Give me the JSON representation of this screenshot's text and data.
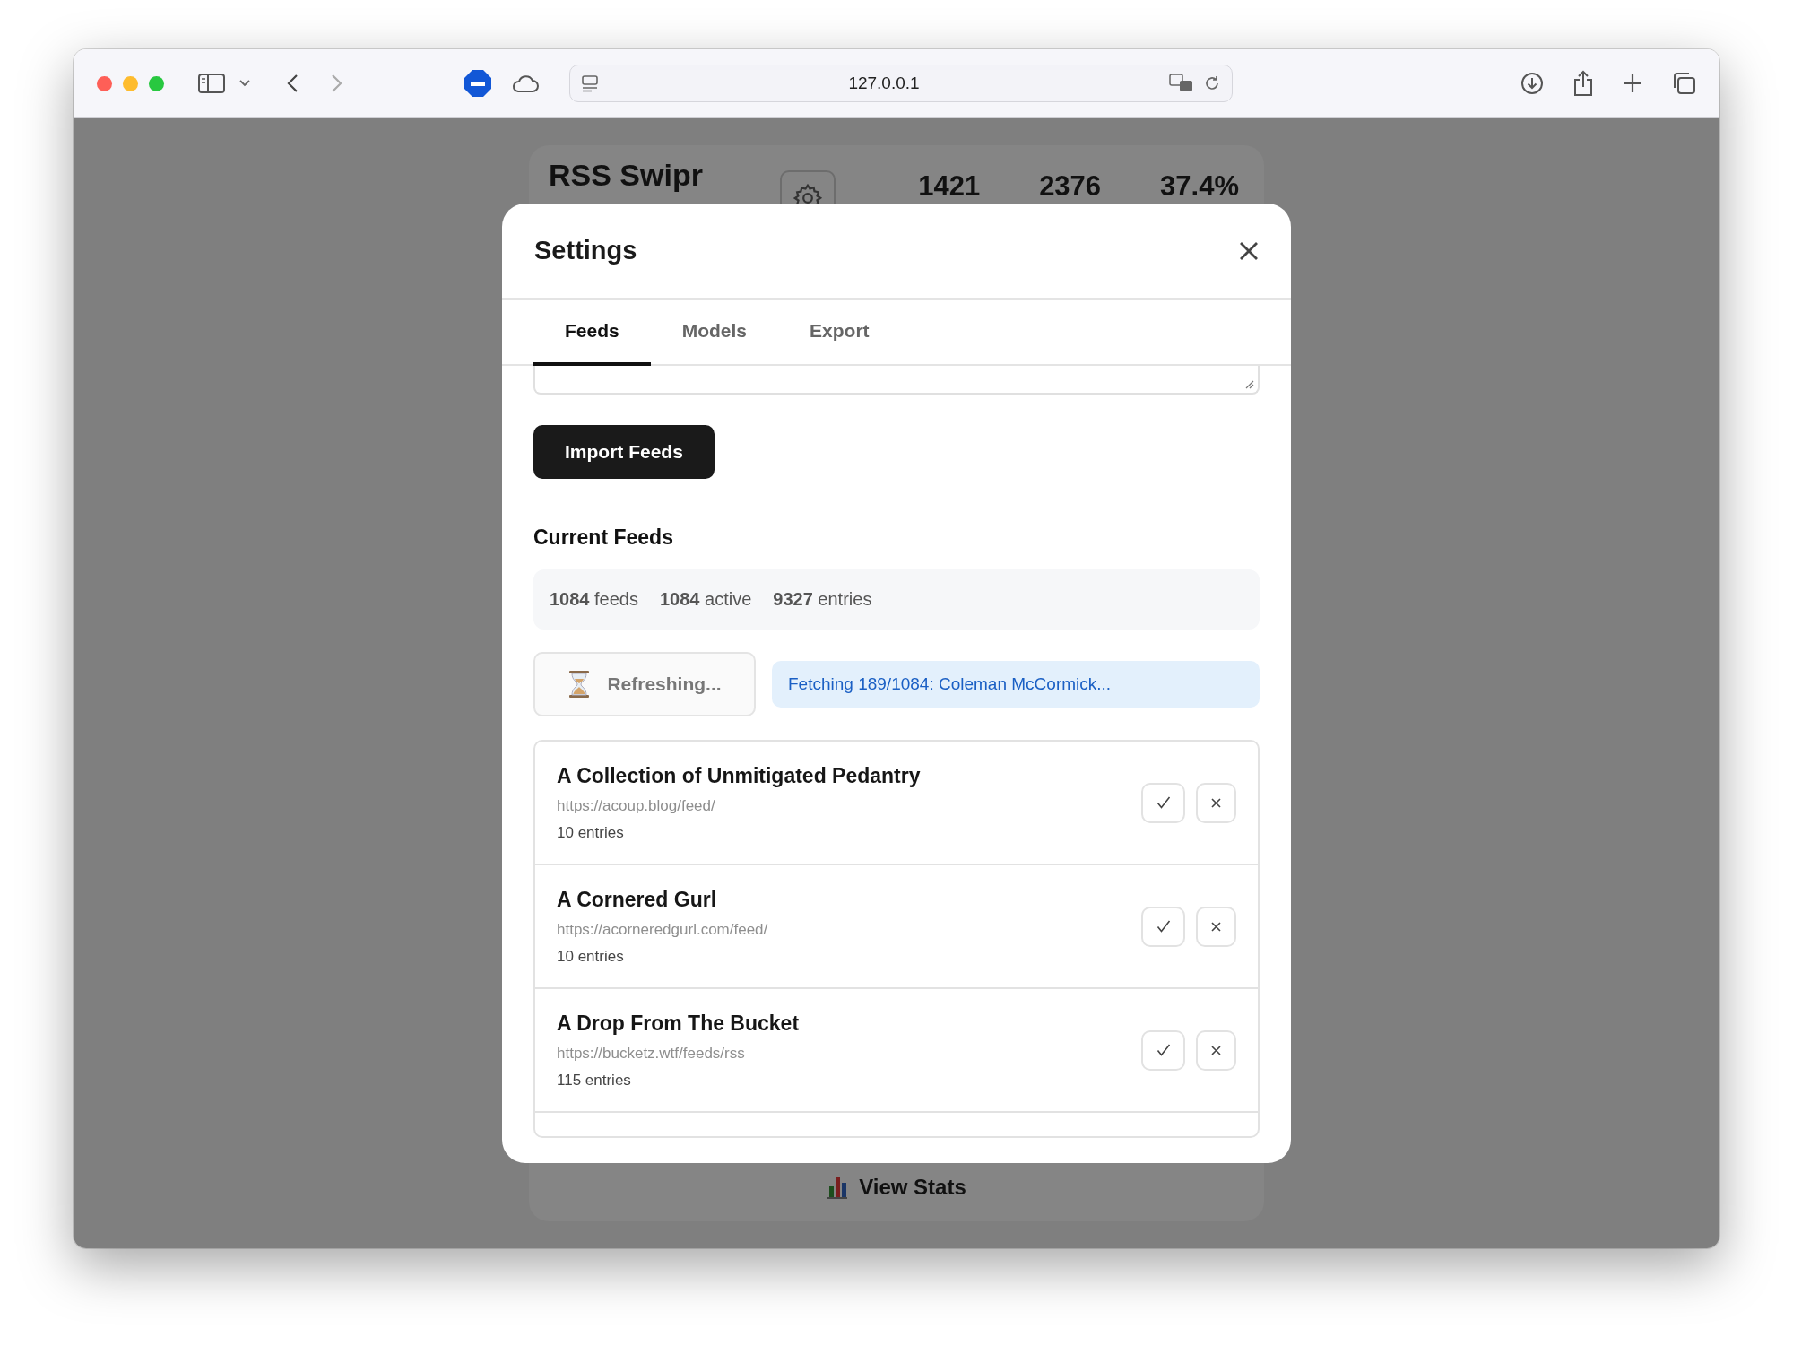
{
  "browser": {
    "address": "127.0.0.1"
  },
  "app": {
    "title": "RSS Swipr",
    "stats": [
      "1421",
      "2376",
      "37.4%"
    ],
    "footer_link": "View Stats"
  },
  "settings_dialog": {
    "title": "Settings",
    "tabs": [
      {
        "label": "Feeds",
        "selected": true
      },
      {
        "label": "Models",
        "selected": false
      },
      {
        "label": "Export",
        "selected": false
      }
    ],
    "import_button": "Import Feeds",
    "section_title": "Current Feeds",
    "summary": [
      {
        "count": "1084",
        "label": "feeds"
      },
      {
        "count": "1084",
        "label": "active"
      },
      {
        "count": "9327",
        "label": "entries"
      }
    ],
    "refresh_button": {
      "label": "Refreshing...",
      "disabled": true
    },
    "status_message": "Fetching 189/1084: Coleman McCormick...",
    "feeds": [
      {
        "title": "A Collection of Unmitigated Pedantry",
        "url": "https://acoup.blog/feed/",
        "entries": "10 entries"
      },
      {
        "title": "A Cornered Gurl",
        "url": "https://acorneredgurl.com/feed/",
        "entries": "10 entries"
      },
      {
        "title": "A Drop From The Bucket",
        "url": "https://bucketz.wtf/feeds/rss",
        "entries": "115 entries"
      }
    ]
  }
}
